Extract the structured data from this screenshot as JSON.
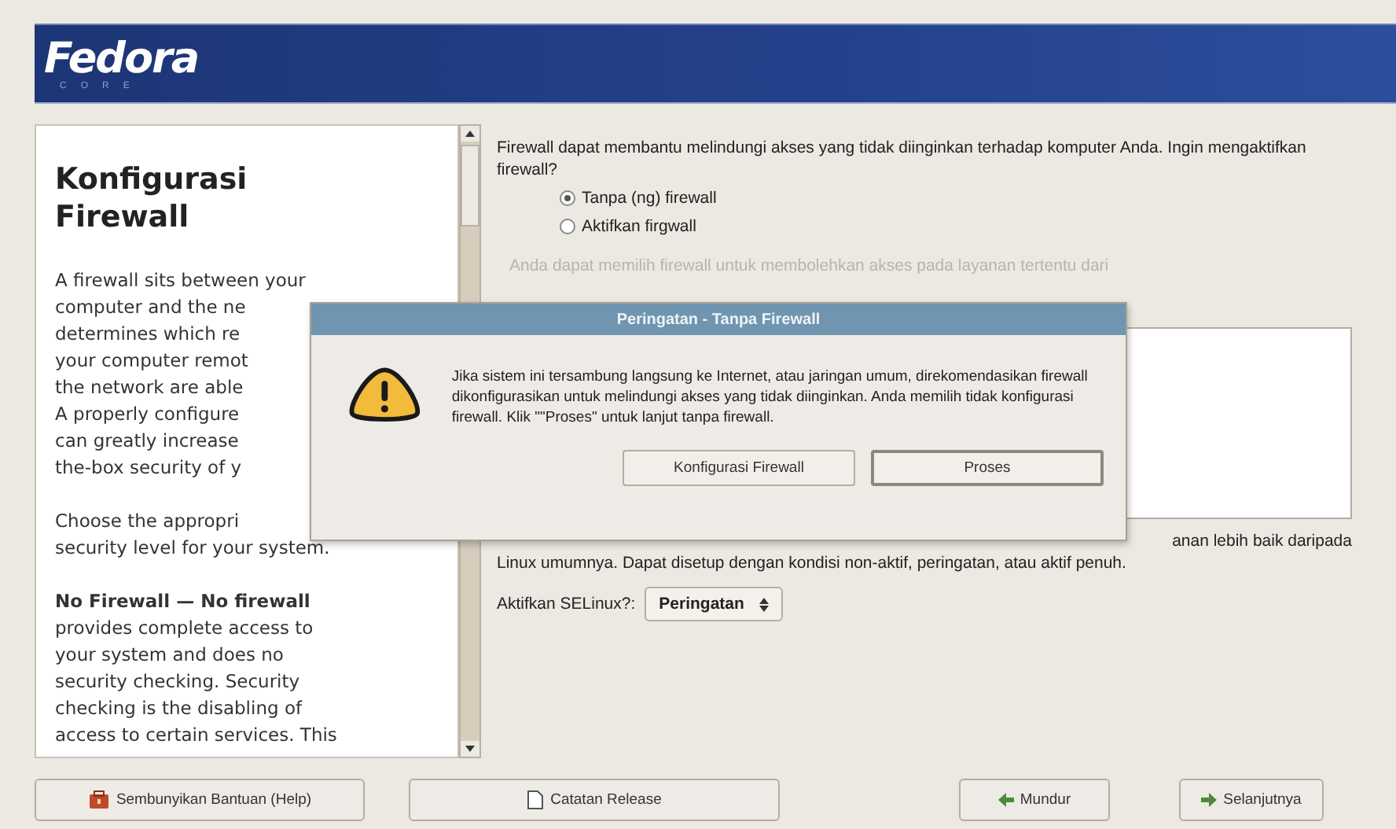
{
  "header": {
    "logo": "Fedora",
    "logo_sub": "CORE"
  },
  "help": {
    "title": "Konfigurasi Firewall",
    "paragraphs": [
      {
        "lines": [
          "A firewall sits between your",
          "computer and the ne",
          "determines which re",
          "your computer remot",
          "the network are able",
          "A properly configure",
          "can greatly increase",
          "the-box security of y"
        ]
      },
      {
        "lines": [
          "Choose the appropri",
          "security level for your system."
        ]
      },
      {
        "lines": [
          "**No Firewall — No firewall**",
          "provides complete access to",
          "your system and does no",
          "security checking. Security",
          "checking is the disabling of",
          "access to certain services. This"
        ]
      }
    ]
  },
  "firewall": {
    "question": "Firewall dapat membantu melindungi akses yang tidak diinginkan terhadap komputer Anda. Ingin mengaktifkan firewall?",
    "options": [
      {
        "label": "Tanpa (ng) firewall",
        "selected": true
      },
      {
        "label": "Aktifkan firgwall",
        "selected": false
      }
    ],
    "services_hint": "Anda dapat memilih firewall untuk membolehkan akses pada layanan tertentu dari",
    "selinux_text_1": "anan lebih baik daripada",
    "selinux_text_2": "Linux umumnya. Dapat disetup dengan kondisi non-aktif, peringatan, atau aktif penuh.",
    "selinux_label": "Aktifkan SELinux?:",
    "selinux_value": "Peringatan"
  },
  "dialog": {
    "title": "Peringatan - Tanpa Firewall",
    "message": "Jika sistem ini tersambung langsung ke Internet, atau jaringan umum, direkomendasikan firewall dikonfigurasikan untuk melindungi akses yang tidak diinginkan. Anda memilih tidak konfigurasi firewall. Klik \"\"Proses\" untuk lanjut tanpa firewall.",
    "buttons": [
      {
        "label": "Konfigurasi Firewall",
        "kind": "normal"
      },
      {
        "label": "Proses",
        "kind": "default"
      }
    ]
  },
  "footer": {
    "buttons": [
      {
        "label": "Sembunyikan Bantuan (Help)",
        "kind": "help"
      },
      {
        "label": "Catatan Release",
        "kind": "notes"
      },
      {
        "label": "Mundur",
        "kind": "back"
      },
      {
        "label": "Selanjutnya",
        "kind": "next"
      }
    ]
  }
}
